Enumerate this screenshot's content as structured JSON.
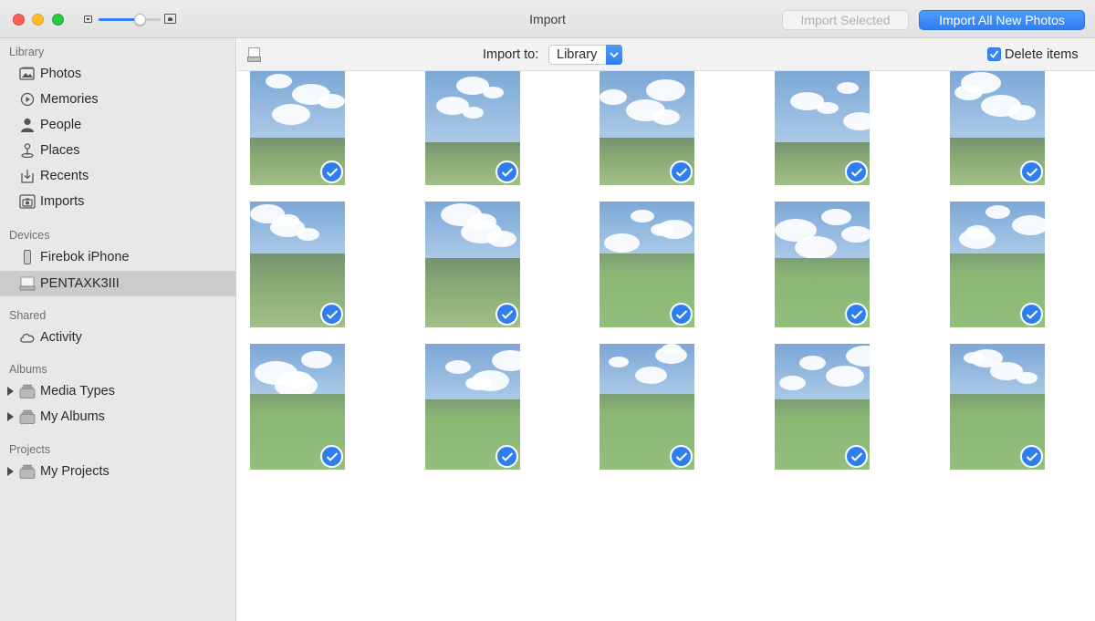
{
  "window": {
    "title": "Import",
    "import_selected_label": "Import Selected",
    "import_all_label": "Import All New Photos"
  },
  "sidebar": {
    "sections": [
      {
        "label": "Library",
        "items": [
          {
            "label": "Photos",
            "icon": "photos-icon"
          },
          {
            "label": "Memories",
            "icon": "memories-icon"
          },
          {
            "label": "People",
            "icon": "people-icon"
          },
          {
            "label": "Places",
            "icon": "places-icon"
          },
          {
            "label": "Recents",
            "icon": "recents-icon"
          },
          {
            "label": "Imports",
            "icon": "imports-icon"
          }
        ]
      },
      {
        "label": "Devices",
        "items": [
          {
            "label": "Firebok iPhone",
            "icon": "iphone-icon"
          },
          {
            "label": "PENTAXK3III",
            "icon": "drive-icon",
            "selected": true
          }
        ]
      },
      {
        "label": "Shared",
        "items": [
          {
            "label": "Activity",
            "icon": "cloud-icon"
          }
        ]
      },
      {
        "label": "Albums",
        "items": [
          {
            "label": "Media Types",
            "icon": "folder-stack-icon"
          },
          {
            "label": "My Albums",
            "icon": "folder-stack-icon"
          }
        ]
      },
      {
        "label": "Projects",
        "items": [
          {
            "label": "My Projects",
            "icon": "folder-stack-icon"
          }
        ]
      }
    ]
  },
  "toolbar": {
    "import_to_label": "Import to:",
    "destination": "Library",
    "delete_items_label": "Delete items",
    "delete_items_checked": true
  },
  "photos": {
    "selected_count": 15,
    "total_count": 15,
    "all_selected": true
  },
  "colors": {
    "accent": "#3a82f7",
    "sidebar_bg": "#e8e8e8",
    "selected_row": "#cbcbcb"
  }
}
